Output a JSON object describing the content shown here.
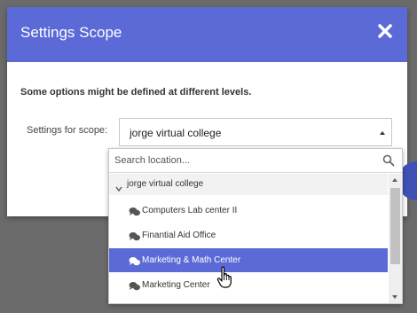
{
  "modal": {
    "title": "Settings Scope",
    "close_icon": "close-icon",
    "info_text": "Some options might be defined at different levels.",
    "scope_label": "Settings for scope:",
    "scope_value": "jorge virtual college"
  },
  "dropdown": {
    "search_placeholder": "Search location...",
    "search_icon": "search-icon",
    "parent": {
      "label": "jorge virtual college",
      "icon": "caret-down-icon"
    },
    "items": [
      {
        "label": "Computers Lab center II",
        "icon": "chat-bubbles-icon",
        "selected": false
      },
      {
        "label": "Finantial Aid Office",
        "icon": "chat-bubbles-icon",
        "selected": false
      },
      {
        "label": "Marketing & Math Center",
        "icon": "chat-bubbles-icon",
        "selected": true
      },
      {
        "label": "Marketing Center",
        "icon": "chat-bubbles-icon",
        "selected": false
      }
    ]
  },
  "colors": {
    "header": "#5b6ad6",
    "selected": "#5b6ad6",
    "backdrop": "#6b6b6b"
  }
}
